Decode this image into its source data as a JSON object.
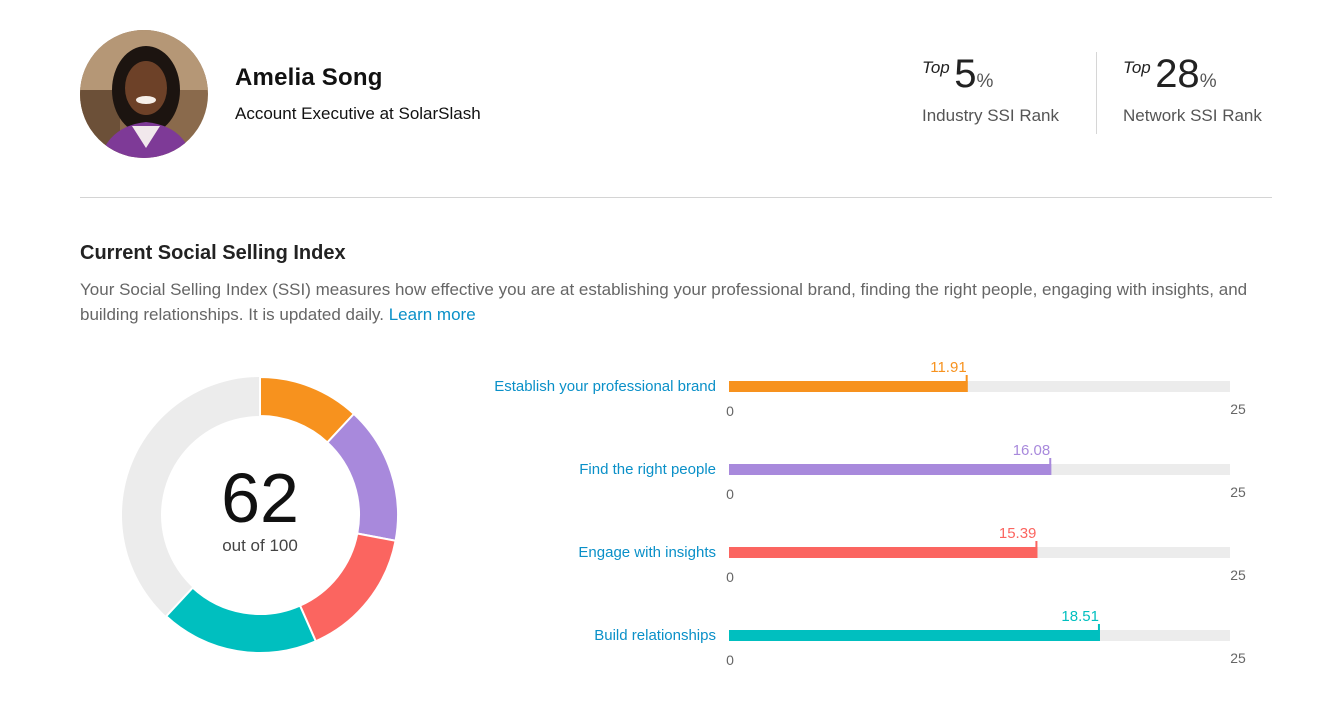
{
  "profile": {
    "name": "Amelia Song",
    "headline": "Account Executive at SolarSlash"
  },
  "ranks": [
    {
      "prefix": "Top",
      "value": "5",
      "unit": "%",
      "label": "Industry SSI Rank"
    },
    {
      "prefix": "Top",
      "value": "28",
      "unit": "%",
      "label": "Network SSI Rank"
    }
  ],
  "section": {
    "title": "Current Social Selling Index",
    "description": "Your Social Selling Index (SSI) measures how effective you are at establishing your professional brand, finding the right people, engaging with insights, and building relationships. It is updated daily.",
    "learn_more": "Learn more"
  },
  "score": {
    "value": "62",
    "caption": "out of 100",
    "total": 100
  },
  "colors": {
    "track": "#ececec",
    "label": "#0a90c8",
    "axis": "#666666"
  },
  "components": [
    {
      "label": "Establish your professional brand",
      "value": 11.91,
      "display": "11.91",
      "max": 25,
      "min_label": "0",
      "max_label": "25",
      "color": "#f7921e"
    },
    {
      "label": "Find the right people",
      "value": 16.08,
      "display": "16.08",
      "max": 25,
      "min_label": "0",
      "max_label": "25",
      "color": "#a889dc"
    },
    {
      "label": "Engage with insights",
      "value": 15.39,
      "display": "15.39",
      "max": 25,
      "min_label": "0",
      "max_label": "25",
      "color": "#fb6560"
    },
    {
      "label": "Build relationships",
      "value": 18.51,
      "display": "18.51",
      "max": 25,
      "min_label": "0",
      "max_label": "25",
      "color": "#00bfbf"
    }
  ]
}
